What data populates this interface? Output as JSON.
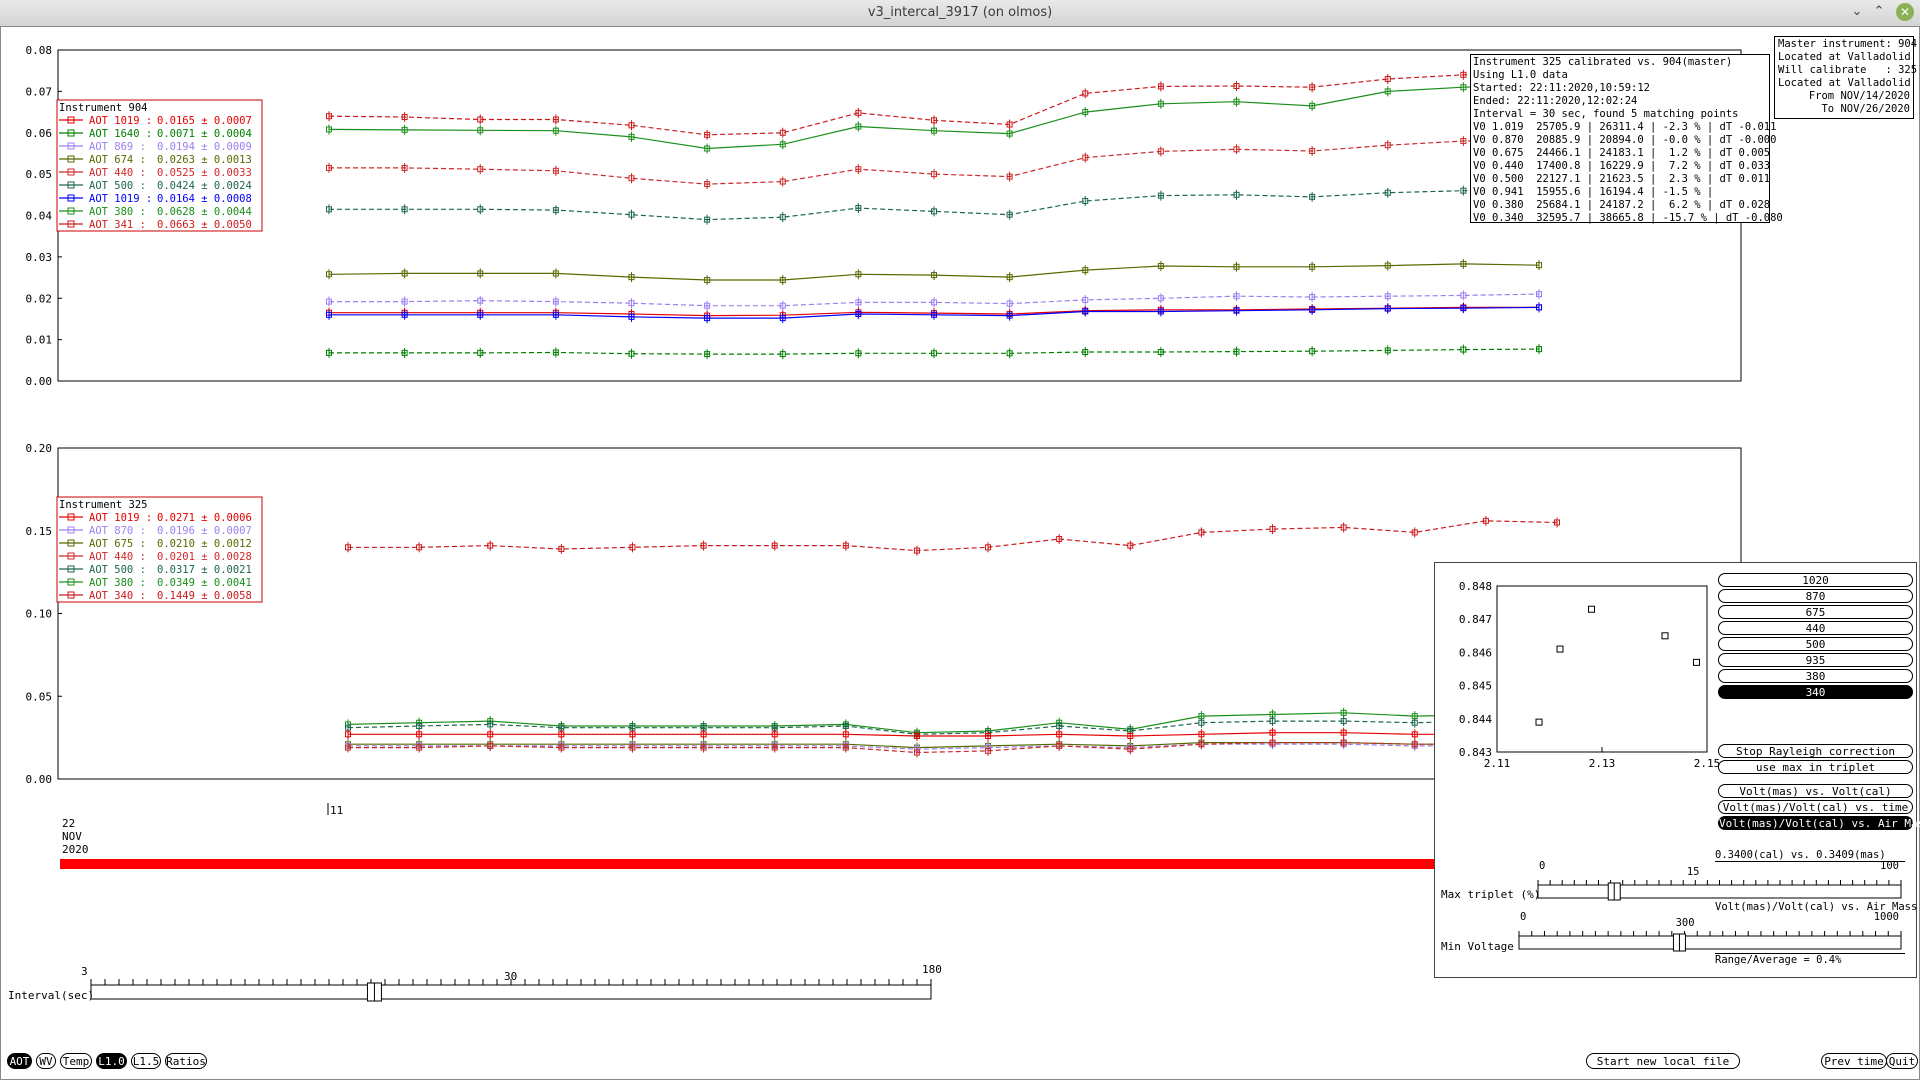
{
  "window": {
    "title": "v3_intercal_3917 (on olmos)",
    "minimize": "⌄",
    "maximize": "⌃",
    "close": "✕"
  },
  "top_chart": {
    "y_ticks": [
      "0.08",
      "0.07",
      "0.06",
      "0.05",
      "0.04",
      "0.03",
      "0.02",
      "0.01",
      "0.00"
    ],
    "legend_title": "Instrument 904",
    "legend": [
      {
        "label": "AOT 1019 :",
        "value": "0.0165 ± 0.0007",
        "color": "#e60000"
      },
      {
        "label": "AOT 1640 :",
        "value": "0.0071 ± 0.0004",
        "color": "#008000"
      },
      {
        "label": "AOT 869 :",
        "value": "0.0194 ± 0.0009",
        "color": "#9c7ff2"
      },
      {
        "label": "AOT 674 :",
        "value": "0.0263 ± 0.0013",
        "color": "#556b00"
      },
      {
        "label": "AOT 440 :",
        "value": "0.0525 ± 0.0033",
        "color": "#cc2a2a"
      },
      {
        "label": "AOT 500 :",
        "value": "0.0424 ± 0.0024",
        "color": "#1d6650"
      },
      {
        "label": "AOT 1019 :",
        "value": "0.0164 ± 0.0008",
        "color": "#0000ff"
      },
      {
        "label": "AOT 380 :",
        "value": "0.0628 ± 0.0044",
        "color": "#1b8f1b"
      },
      {
        "label": "AOT 341 :",
        "value": "0.0663 ± 0.0050",
        "color": "#cc1a1a"
      }
    ]
  },
  "info_box": {
    "lines": [
      "Instrument 325 calibrated vs. 904(master)",
      "Using L1.0 data",
      "Started: 22:11:2020,10:59:12",
      "Ended: 22:11:2020,12:02:24",
      "Interval = 30 sec, found 5 matching points",
      "V0 1.019  25705.9 | 26311.4 | -2.3 % | dT -0.011",
      "V0 0.870  20885.9 | 20894.0 | -0.0 % | dT -0.000",
      "V0 0.675  24466.1 | 24183.1 |  1.2 % | dT 0.005",
      "V0 0.440  17400.8 | 16229.9 |  7.2 % | dT 0.033",
      "V0 0.500  22127.1 | 21623.5 |  2.3 % | dT 0.011",
      "V0 0.941  15955.6 | 16194.4 | -1.5 % |",
      "V0 0.380  25684.1 | 24187.2 |  6.2 % | dT 0.028",
      "V0 0.340  32595.7 | 38665.8 | -15.7 % | dT -0.080"
    ]
  },
  "master_box": {
    "lines": [
      "Master instrument: 904",
      "Located at Valladolid",
      "Will calibrate   : 325",
      "Located at Valladolid",
      "From NOV/14/2020",
      "To NOV/26/2020"
    ]
  },
  "bottom_chart": {
    "y_ticks": [
      "0.20",
      "0.15",
      "0.10",
      "0.05",
      "0.00"
    ],
    "legend_title": "Instrument 325",
    "legend": [
      {
        "label": "AOT 1019 :",
        "value": "0.0271 ± 0.0006",
        "color": "#e60000"
      },
      {
        "label": "AOT 870 :",
        "value": "0.0196 ± 0.0007",
        "color": "#9c7ff2"
      },
      {
        "label": "AOT 675 :",
        "value": "0.0210 ± 0.0012",
        "color": "#556b00"
      },
      {
        "label": "AOT 440 :",
        "value": "0.0201 ± 0.0028",
        "color": "#cc2a2a"
      },
      {
        "label": "AOT 500 :",
        "value": "0.0317 ± 0.0021",
        "color": "#1d6650"
      },
      {
        "label": "AOT 380 :",
        "value": "0.0349 ± 0.0041",
        "color": "#1b8f1b"
      },
      {
        "label": "AOT 340 :",
        "value": "0.1449 ± 0.0058",
        "color": "#cc1a1a"
      }
    ]
  },
  "time_axis": {
    "hour_label": "11",
    "date_day": "22",
    "date_month": "NOV",
    "date_year": "2020"
  },
  "inset": {
    "y_ticks": [
      "0.848",
      "0.847",
      "0.846",
      "0.845",
      "0.844",
      "0.843"
    ],
    "x_ticks": [
      "2.11",
      "2.13",
      "2.15"
    ],
    "wavelength_buttons": [
      "1020",
      "870",
      "675",
      "440",
      "500",
      "935",
      "380",
      "340"
    ],
    "selected_wavelength": "340",
    "stop_rayleigh": "Stop Rayleigh correction",
    "use_max": "use max in triplet",
    "plot_modes": [
      "Volt(mas) vs. Volt(cal)",
      "Volt(mas)/Volt(cal) vs. time",
      "Volt(mas)/Volt(cal) vs. Air Mass"
    ],
    "selected_mode": "Volt(mas)/Volt(cal) vs. Air Mass",
    "ratio_label": "0.3400(cal) vs. 0.3409(mas)",
    "mode_label": "Volt(mas)/Volt(cal) vs. Air Mass",
    "range_avg": "Range/Average = 0.4%",
    "max_triplet": {
      "label": "Max triplet (%)",
      "min": "0",
      "mid": "15",
      "max": "100",
      "value": 15
    },
    "min_voltage": {
      "label": "Min Voltage",
      "min": "0",
      "mid": "300",
      "max": "1000",
      "value": 300
    }
  },
  "interval_slider": {
    "label": "Interval(sec)",
    "min": "3",
    "mid": "30",
    "max": "180",
    "value": 30
  },
  "bottom_bar": {
    "left": [
      {
        "label": "AOT",
        "selected": true
      },
      {
        "label": "WV",
        "selected": false
      },
      {
        "label": "Temp",
        "selected": false
      },
      {
        "label": "L1.0",
        "selected": true
      },
      {
        "label": "L1.5",
        "selected": false
      },
      {
        "label": "Ratios",
        "selected": false
      }
    ],
    "start_new": "Start new local file",
    "prev_time": "Prev time",
    "quit": "Quit"
  },
  "chart_data": [
    {
      "type": "line",
      "ylim": [
        0,
        0.08
      ],
      "x": [
        1,
        2,
        3,
        4,
        5,
        6,
        7,
        8,
        9,
        10,
        11,
        12,
        13,
        14,
        15,
        16,
        17
      ],
      "series": [
        {
          "name": "AOT 1019",
          "color": "#e60000",
          "dash": false,
          "values": [
            0.0165,
            0.0165,
            0.0165,
            0.0165,
            0.0162,
            0.0158,
            0.0159,
            0.0166,
            0.0164,
            0.0162,
            0.017,
            0.0172,
            0.0172,
            0.0174,
            0.0176,
            0.0178,
            0.0178
          ]
        },
        {
          "name": "AOT 1640",
          "color": "#008000",
          "dash": true,
          "values": [
            0.0068,
            0.0068,
            0.0068,
            0.0069,
            0.0066,
            0.0065,
            0.0065,
            0.0067,
            0.0067,
            0.0067,
            0.007,
            0.007,
            0.0071,
            0.0072,
            0.0074,
            0.0076,
            0.0077
          ]
        },
        {
          "name": "AOT 869",
          "color": "#9c7ff2",
          "dash": true,
          "values": [
            0.0192,
            0.0192,
            0.0194,
            0.0192,
            0.0188,
            0.0182,
            0.0182,
            0.019,
            0.019,
            0.0187,
            0.0196,
            0.02,
            0.0205,
            0.0203,
            0.0205,
            0.0207,
            0.021
          ]
        },
        {
          "name": "AOT 674",
          "color": "#556b00",
          "dash": false,
          "values": [
            0.0258,
            0.026,
            0.026,
            0.026,
            0.0251,
            0.0244,
            0.0244,
            0.0258,
            0.0256,
            0.0251,
            0.0268,
            0.0278,
            0.0276,
            0.0276,
            0.0279,
            0.0283,
            0.028
          ]
        },
        {
          "name": "AOT 440",
          "color": "#cc2a2a",
          "dash": true,
          "values": [
            0.0515,
            0.0515,
            0.0512,
            0.0508,
            0.049,
            0.0476,
            0.0482,
            0.0512,
            0.05,
            0.0494,
            0.054,
            0.0555,
            0.056,
            0.0556,
            0.057,
            0.058,
            0.058
          ]
        },
        {
          "name": "AOT 500",
          "color": "#1d6650",
          "dash": true,
          "values": [
            0.0415,
            0.0415,
            0.0415,
            0.0413,
            0.0402,
            0.039,
            0.0396,
            0.0418,
            0.041,
            0.0402,
            0.0435,
            0.0448,
            0.045,
            0.0445,
            0.0455,
            0.046,
            0.046
          ]
        },
        {
          "name": "AOT 1019",
          "color": "#0000ff",
          "dash": false,
          "values": [
            0.016,
            0.016,
            0.016,
            0.016,
            0.0155,
            0.0152,
            0.0152,
            0.0162,
            0.016,
            0.0158,
            0.0168,
            0.0168,
            0.017,
            0.0172,
            0.0175,
            0.0176,
            0.0178
          ]
        },
        {
          "name": "AOT 380",
          "color": "#1b8f1b",
          "dash": false,
          "values": [
            0.0608,
            0.0607,
            0.0606,
            0.0605,
            0.059,
            0.0562,
            0.0572,
            0.0615,
            0.0605,
            0.0598,
            0.065,
            0.067,
            0.0675,
            0.0665,
            0.07,
            0.071,
            0.0715
          ]
        },
        {
          "name": "AOT 341",
          "color": "#cc1a1a",
          "dash": true,
          "values": [
            0.064,
            0.0638,
            0.0632,
            0.0632,
            0.0618,
            0.0595,
            0.06,
            0.0648,
            0.063,
            0.062,
            0.0695,
            0.0712,
            0.0713,
            0.071,
            0.073,
            0.074,
            0.0745
          ]
        }
      ]
    },
    {
      "type": "line",
      "ylim": [
        0,
        0.2
      ],
      "x": [
        1,
        2,
        3,
        4,
        5,
        6,
        7,
        8,
        9,
        10,
        11,
        12,
        13,
        14,
        15,
        16,
        17,
        18
      ],
      "series": [
        {
          "name": "AOT 340",
          "color": "#cc1a1a",
          "dash": true,
          "values": [
            0.14,
            0.14,
            0.141,
            0.139,
            0.14,
            0.141,
            0.141,
            0.141,
            0.138,
            0.14,
            0.145,
            0.141,
            0.149,
            0.151,
            0.152,
            0.149,
            0.156,
            0.155
          ]
        },
        {
          "name": "AOT 380",
          "color": "#1b8f1b",
          "dash": false,
          "values": [
            0.033,
            0.034,
            0.035,
            0.032,
            0.032,
            0.032,
            0.032,
            0.033,
            0.028,
            0.029,
            0.034,
            0.03,
            0.038,
            0.039,
            0.04,
            0.038,
            0.039,
            0.039
          ]
        },
        {
          "name": "AOT 500",
          "color": "#1d6650",
          "dash": true,
          "values": [
            0.031,
            0.032,
            0.033,
            0.031,
            0.031,
            0.031,
            0.031,
            0.032,
            0.027,
            0.028,
            0.032,
            0.029,
            0.034,
            0.035,
            0.035,
            0.034,
            0.035,
            0.035
          ]
        },
        {
          "name": "AOT 1019",
          "color": "#e60000",
          "dash": false,
          "values": [
            0.027,
            0.027,
            0.027,
            0.027,
            0.027,
            0.027,
            0.027,
            0.027,
            0.026,
            0.026,
            0.027,
            0.026,
            0.027,
            0.028,
            0.028,
            0.027,
            0.027,
            0.027
          ]
        },
        {
          "name": "AOT 675",
          "color": "#556b00",
          "dash": false,
          "values": [
            0.021,
            0.021,
            0.021,
            0.021,
            0.021,
            0.021,
            0.021,
            0.021,
            0.019,
            0.02,
            0.021,
            0.02,
            0.022,
            0.022,
            0.022,
            0.021,
            0.021,
            0.021
          ]
        },
        {
          "name": "AOT 870",
          "color": "#9c7ff2",
          "dash": true,
          "values": [
            0.02,
            0.02,
            0.02,
            0.02,
            0.02,
            0.02,
            0.02,
            0.02,
            0.018,
            0.019,
            0.02,
            0.019,
            0.021,
            0.021,
            0.021,
            0.02,
            0.02,
            0.02
          ]
        },
        {
          "name": "AOT 440",
          "color": "#cc2a2a",
          "dash": true,
          "values": [
            0.019,
            0.019,
            0.02,
            0.019,
            0.019,
            0.019,
            0.019,
            0.019,
            0.016,
            0.017,
            0.02,
            0.018,
            0.021,
            0.022,
            0.022,
            0.021,
            0.021,
            0.021
          ]
        }
      ]
    },
    {
      "type": "scatter",
      "xlim": [
        2.11,
        2.15
      ],
      "ylim": [
        0.843,
        0.848
      ],
      "points": [
        [
          2.118,
          0.8439
        ],
        [
          2.122,
          0.8461
        ],
        [
          2.128,
          0.8473
        ],
        [
          2.142,
          0.8465
        ],
        [
          2.148,
          0.8457
        ]
      ]
    }
  ]
}
